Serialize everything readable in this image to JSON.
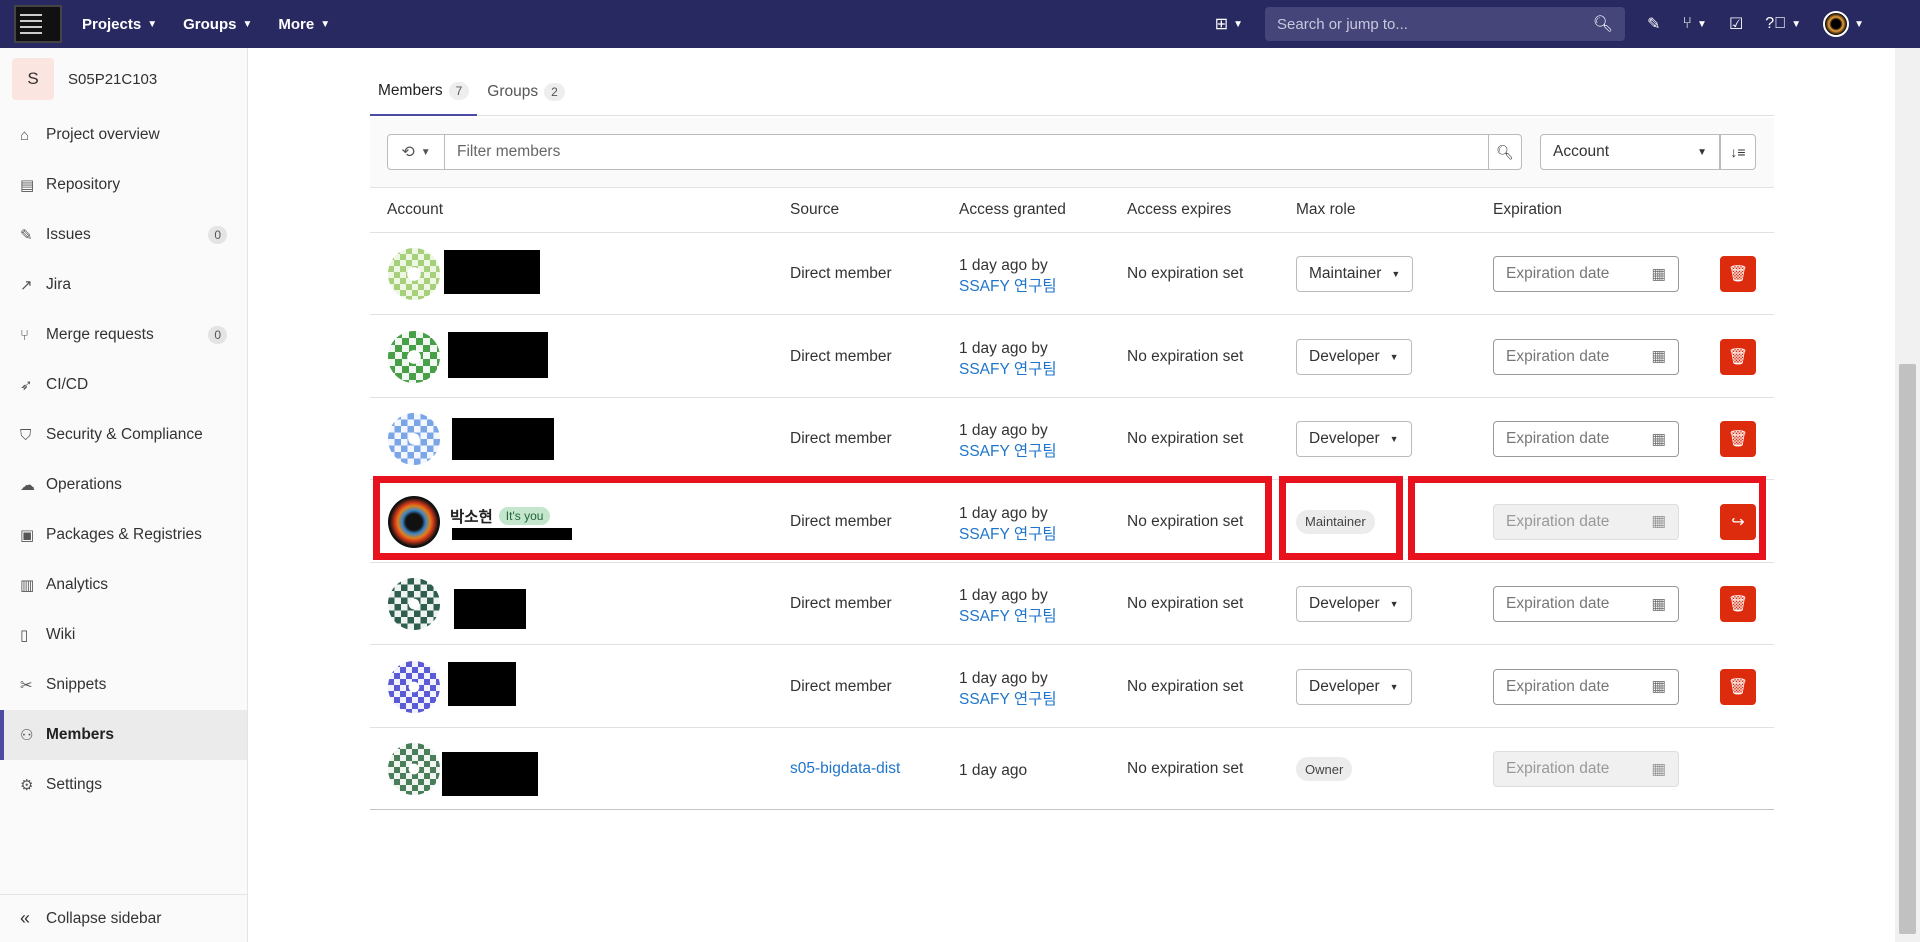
{
  "topbar": {
    "nav": [
      "Projects",
      "Groups",
      "More"
    ],
    "search_placeholder": "Search or jump to..."
  },
  "sidebar": {
    "project_initial": "S",
    "project_name": "S05P21C103",
    "items": [
      {
        "label": "Project overview",
        "icon": "home-icon"
      },
      {
        "label": "Repository",
        "icon": "doc-icon"
      },
      {
        "label": "Issues",
        "icon": "issues-icon",
        "count": "0"
      },
      {
        "label": "Jira",
        "icon": "external-link-icon"
      },
      {
        "label": "Merge requests",
        "icon": "merge-icon",
        "count": "0"
      },
      {
        "label": "CI/CD",
        "icon": "rocket-icon"
      },
      {
        "label": "Security & Compliance",
        "icon": "shield-icon"
      },
      {
        "label": "Operations",
        "icon": "cloud-icon"
      },
      {
        "label": "Packages & Registries",
        "icon": "package-icon"
      },
      {
        "label": "Analytics",
        "icon": "chart-icon"
      },
      {
        "label": "Wiki",
        "icon": "book-icon"
      },
      {
        "label": "Snippets",
        "icon": "scissors-icon"
      },
      {
        "label": "Members",
        "icon": "users-icon",
        "active": true
      },
      {
        "label": "Settings",
        "icon": "gear-icon"
      }
    ],
    "collapse_label": "Collapse sidebar"
  },
  "tabs": [
    {
      "label": "Members",
      "count": "7"
    },
    {
      "label": "Groups",
      "count": "2"
    }
  ],
  "filter": {
    "placeholder": "Filter members",
    "sort_label": "Account"
  },
  "table": {
    "headers": [
      "Account",
      "Source",
      "Access granted",
      "Access expires",
      "Max role",
      "Expiration"
    ],
    "rows": [
      {
        "source": "Direct member",
        "granted": "1 day ago by",
        "granted_by": "SSAFY 연구팀",
        "expires": "No expiration set",
        "role": "Maintainer",
        "role_editable": true,
        "expiration_placeholder": "Expiration date"
      },
      {
        "source": "Direct member",
        "granted": "1 day ago by",
        "granted_by": "SSAFY 연구팀",
        "expires": "No expiration set",
        "role": "Developer",
        "role_editable": true,
        "expiration_placeholder": "Expiration date"
      },
      {
        "source": "Direct member",
        "granted": "1 day ago by",
        "granted_by": "SSAFY 연구팀",
        "expires": "No expiration set",
        "role": "Developer",
        "role_editable": true,
        "expiration_placeholder": "Expiration date"
      },
      {
        "name": "박소현",
        "you_badge": "It's you",
        "source": "Direct member",
        "granted": "1 day ago by",
        "granted_by": "SSAFY 연구팀",
        "expires": "No expiration set",
        "role": "Maintainer",
        "role_editable": false,
        "expiration_placeholder": "Expiration date"
      },
      {
        "source": "Direct member",
        "granted": "1 day ago by",
        "granted_by": "SSAFY 연구팀",
        "expires": "No expiration set",
        "role": "Developer",
        "role_editable": true,
        "expiration_placeholder": "Expiration date"
      },
      {
        "source": "Direct member",
        "granted": "1 day ago by",
        "granted_by": "SSAFY 연구팀",
        "expires": "No expiration set",
        "role": "Developer",
        "role_editable": true,
        "expiration_placeholder": "Expiration date"
      },
      {
        "source": "s05-bigdata-dist",
        "granted": "1 day ago",
        "expires": "No expiration set",
        "role": "Owner",
        "role_editable": false,
        "expiration_placeholder": "Expiration date"
      }
    ]
  },
  "colors": {
    "topbar": "#292961",
    "accent": "#4b4ba3",
    "danger": "#dd2b0e",
    "link": "#1f75cb",
    "highlight": "#e8121e"
  }
}
